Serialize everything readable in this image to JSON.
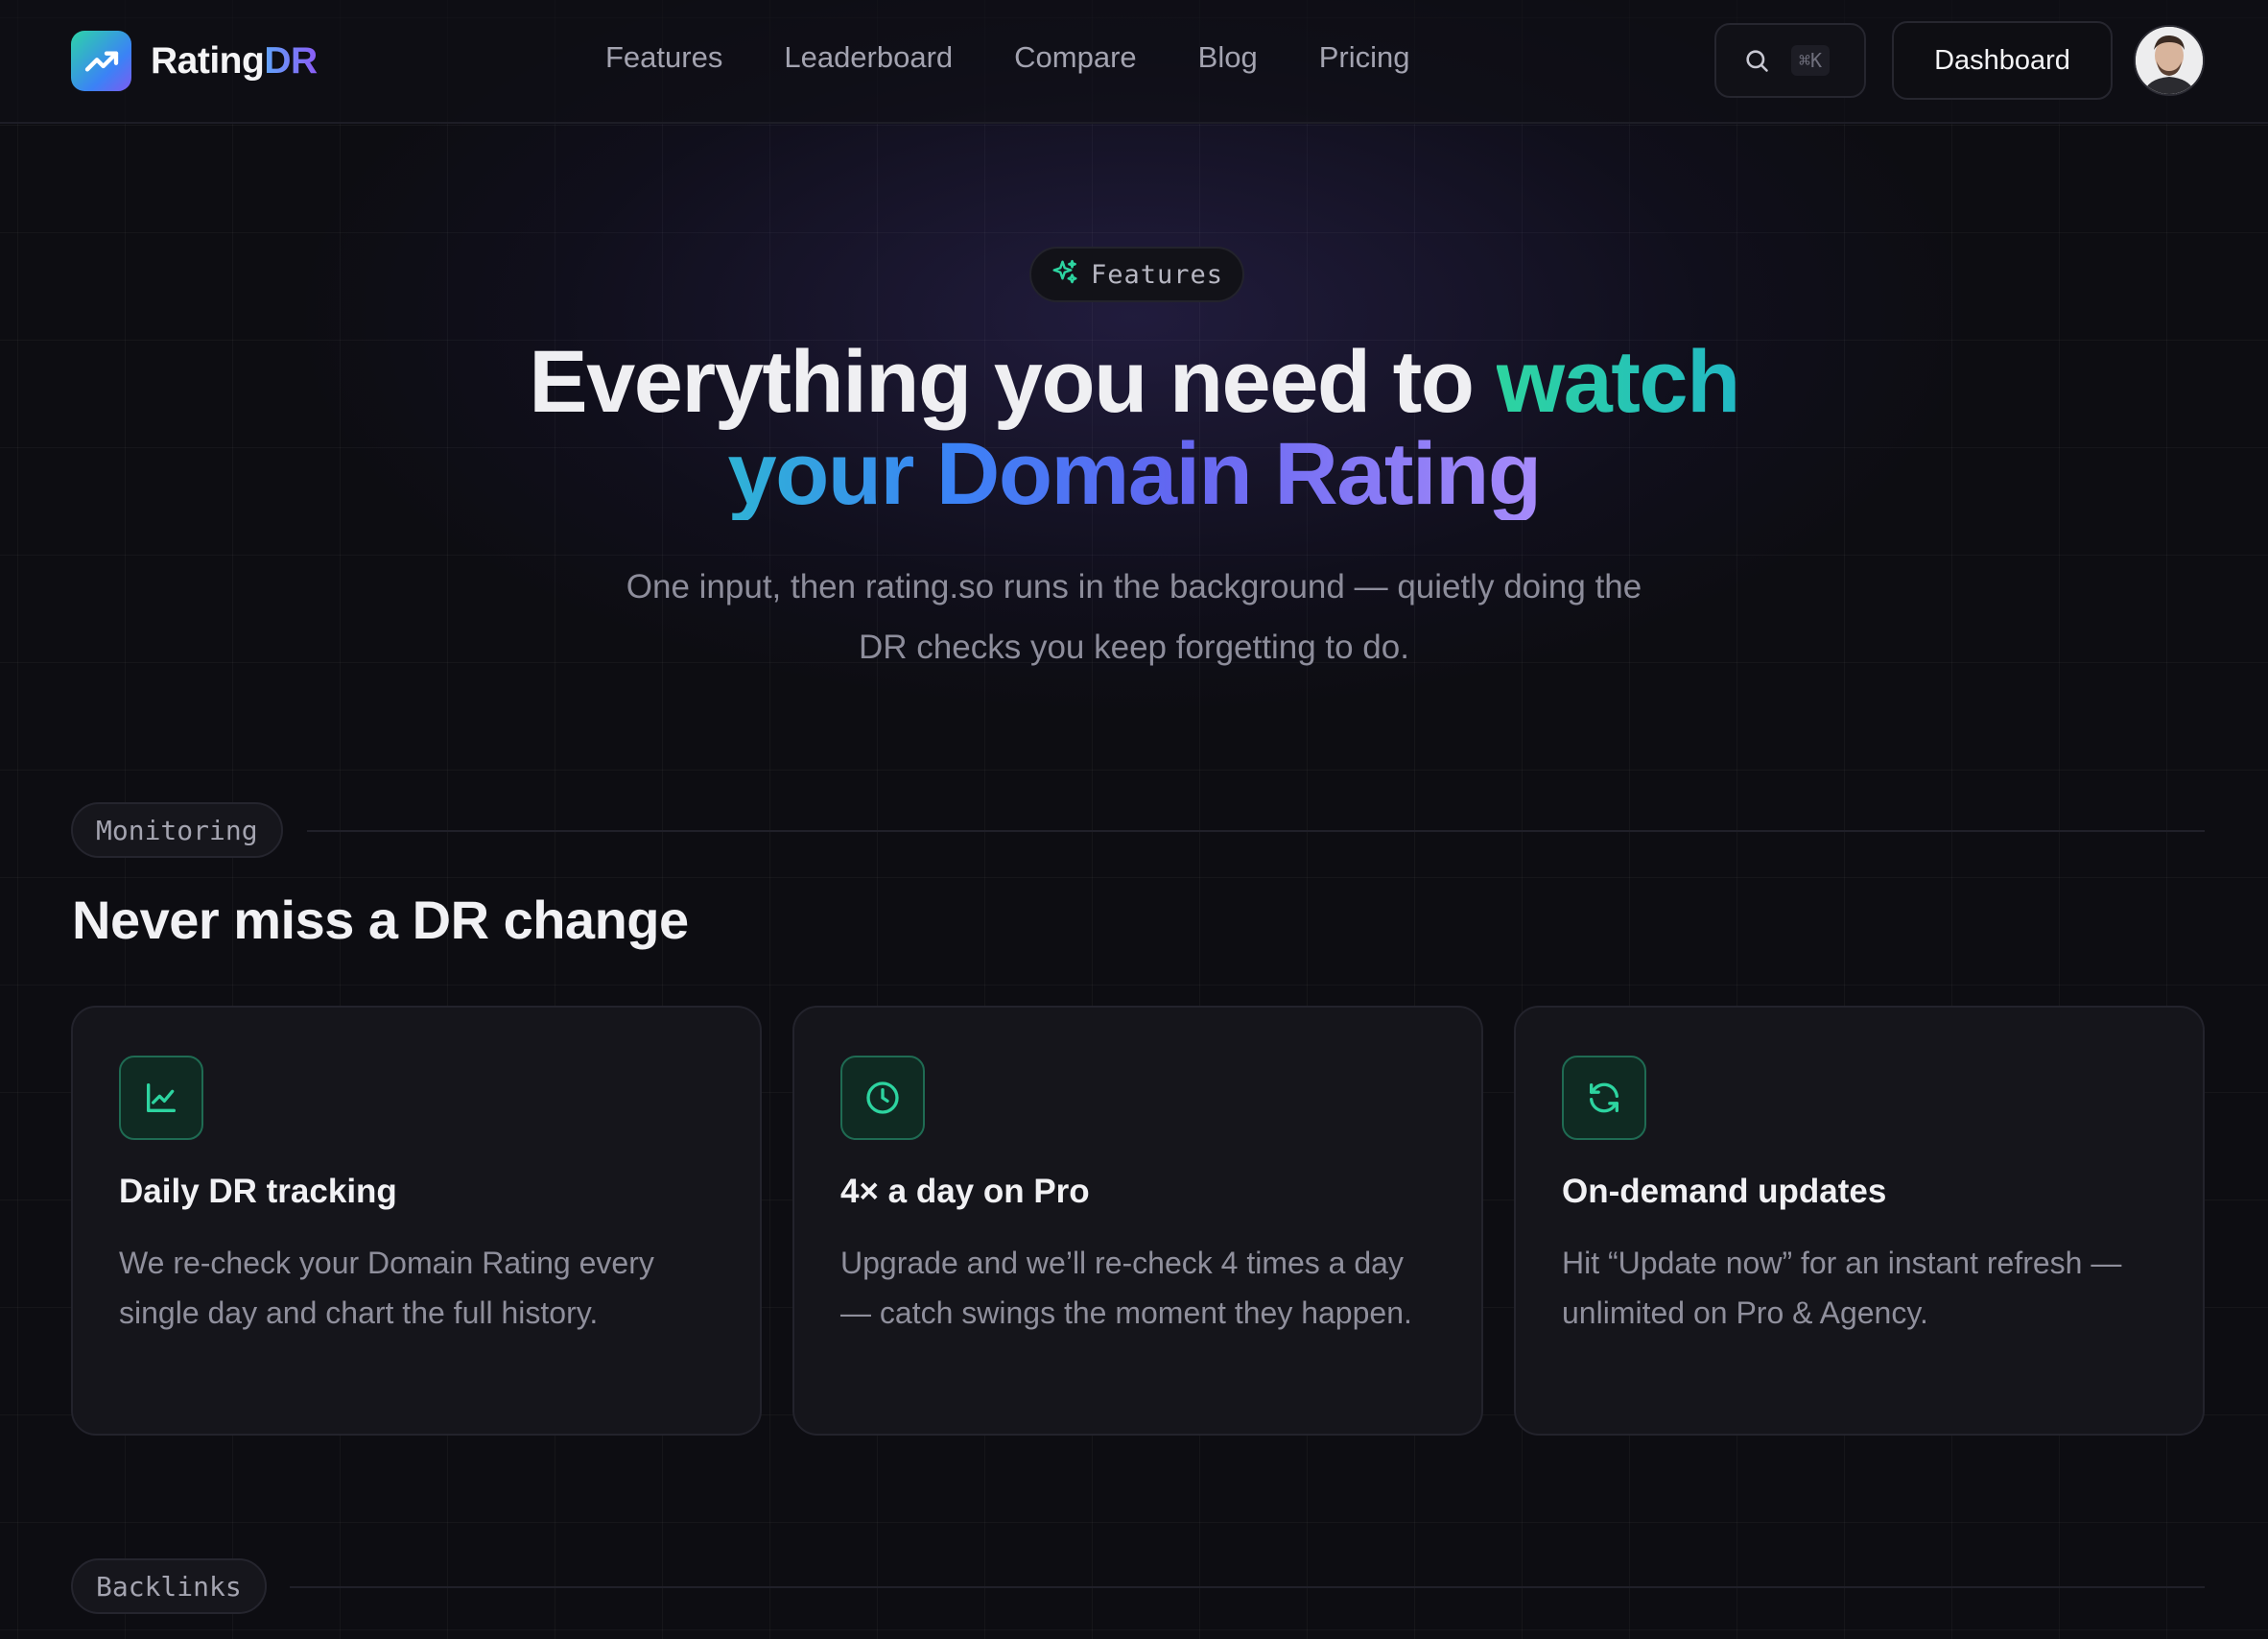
{
  "brand": {
    "name_part1": "Rating",
    "name_part2": "DR"
  },
  "nav": {
    "links": [
      {
        "label": "Features"
      },
      {
        "label": "Leaderboard"
      },
      {
        "label": "Compare"
      },
      {
        "label": "Blog"
      },
      {
        "label": "Pricing"
      }
    ],
    "search_shortcut": "⌘K",
    "dashboard_label": "Dashboard"
  },
  "hero": {
    "pill_label": "Features",
    "headline_white": "Everything you need to",
    "headline_accent": "watch",
    "headline_line2": "your Domain Rating",
    "subtitle": "One input, then rating.so runs in the background — quietly doing the DR checks you keep forgetting to do."
  },
  "monitoring": {
    "tag": "Monitoring",
    "title": "Never miss a DR change",
    "cards": [
      {
        "icon": "line-chart-icon",
        "title": "Daily DR tracking",
        "desc": "We re-check your Domain Rating every single day and chart the full history."
      },
      {
        "icon": "clock-icon",
        "title": "4× a day on Pro",
        "desc": "Upgrade and we’ll re-check 4 times a day — catch swings the moment they happen."
      },
      {
        "icon": "refresh-icon",
        "title": "On-demand updates",
        "desc": "Hit “Update now” for an instant refresh — unlimited on Pro & Agency."
      }
    ]
  },
  "backlinks": {
    "tag": "Backlinks"
  },
  "colors": {
    "background": "#0d0d12",
    "accent_green": "#2dd4a0",
    "accent_blue": "#3b82f6",
    "accent_violet": "#a78bfa",
    "muted_text": "#8d8d9b"
  }
}
